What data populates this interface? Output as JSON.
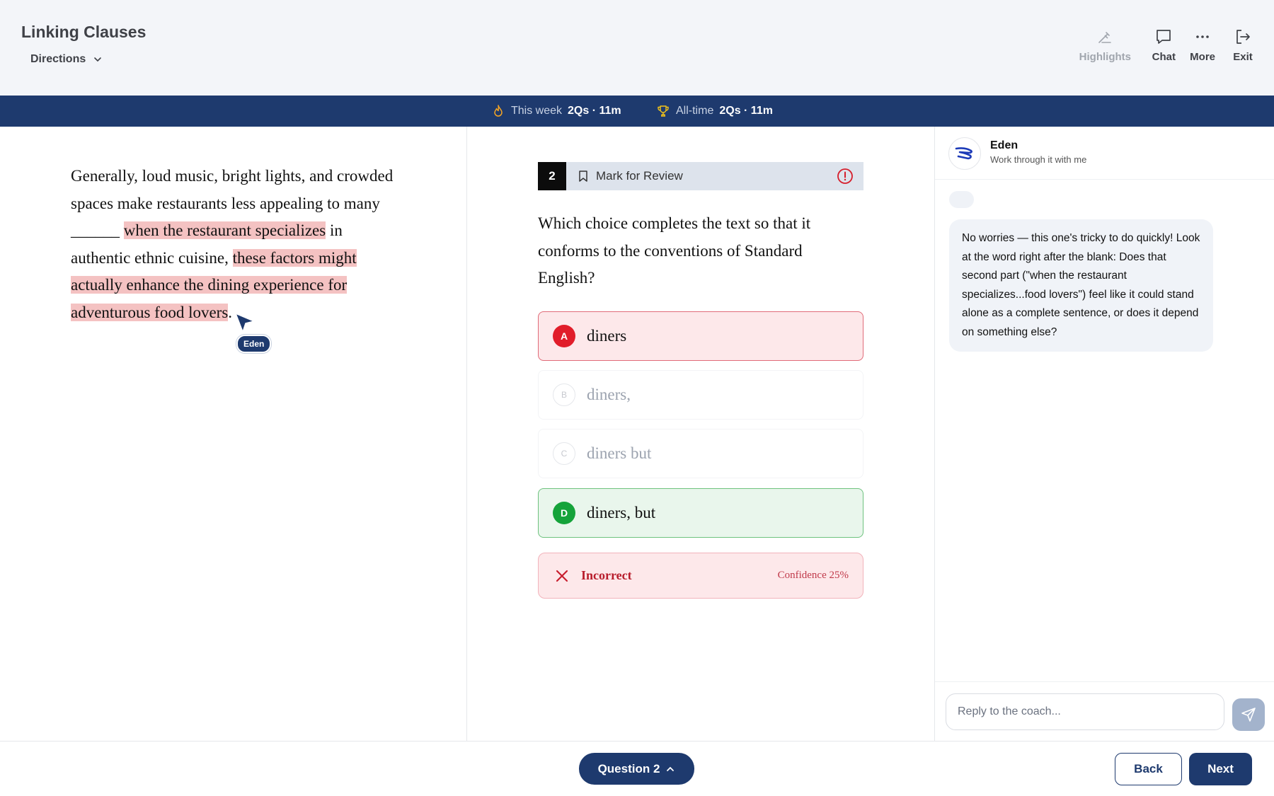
{
  "header": {
    "title": "Linking Clauses",
    "directions_label": "Directions",
    "tools": [
      {
        "label": "Highlights",
        "icon": "highlighter-icon",
        "enabled": false
      },
      {
        "label": "Chat",
        "icon": "chat-icon",
        "enabled": true
      },
      {
        "label": "More",
        "icon": "more-icon",
        "enabled": true
      },
      {
        "label": "Exit",
        "icon": "exit-icon",
        "enabled": true
      }
    ]
  },
  "stats": {
    "week_label": "This week",
    "week_value": "2Qs · 11m",
    "alltime_label": "All-time",
    "alltime_value": "2Qs · 11m"
  },
  "passage": {
    "text_plain_1": "Generally, loud music, bright lights, and crowded spaces make restaurants less appealing to many ______",
    "highlight_1": "when the restaurant specializes",
    "text_plain_2": "in authentic ethnic cuisine,",
    "highlight_2": "these factors might actually enhance the dining experience for adventurous food lovers",
    "text_plain_3": ".",
    "cursor_label": "Eden"
  },
  "question": {
    "number": "2",
    "mark_label": "Mark for Review",
    "prompt": "Which choice completes the text so that it conforms to the conventions of Standard English?",
    "choices": [
      {
        "letter": "A",
        "text": "diners",
        "state": "incorrect-selected"
      },
      {
        "letter": "B",
        "text": "diners,",
        "state": "eliminated"
      },
      {
        "letter": "C",
        "text": "diners but",
        "state": "eliminated"
      },
      {
        "letter": "D",
        "text": "diners, but",
        "state": "correct"
      }
    ],
    "result_label": "Incorrect",
    "confidence_label": "Confidence 25%"
  },
  "chat": {
    "coach_name": "Eden",
    "coach_subtitle": "Work through it with me",
    "message": "No worries — this one's tricky to do quickly! Look at the word right after the blank: Does that second part (\"when the restaurant specializes...food lovers\") feel like it could stand alone as a complete sentence, or does it depend on something else?",
    "reply_placeholder": "Reply to the coach..."
  },
  "footer": {
    "question_pill": "Question 2",
    "back_label": "Back",
    "next_label": "Next"
  },
  "colors": {
    "navy": "#1e3a6e",
    "incorrect": "#e11d2a",
    "correct": "#15a33a",
    "highlight": "#f4c2c2"
  }
}
